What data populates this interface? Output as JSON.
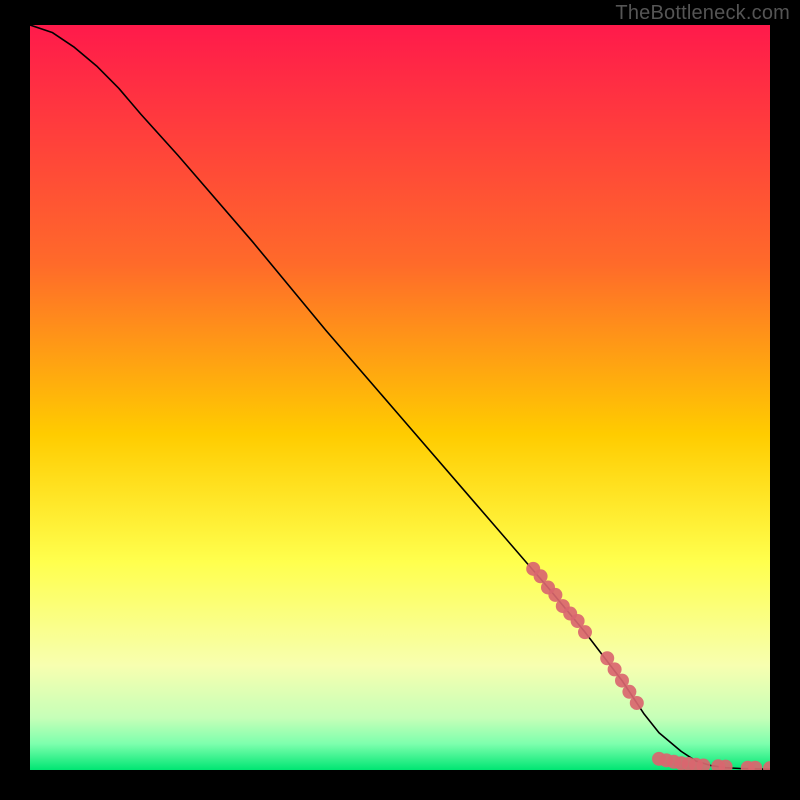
{
  "watermark": "TheBottleneck.com",
  "chart_data": {
    "type": "line",
    "title": "",
    "xlabel": "",
    "ylabel": "",
    "xlim": [
      0,
      100
    ],
    "ylim": [
      0,
      100
    ],
    "grid": false,
    "legend": false,
    "background_gradient": {
      "top": "#ff1a4b",
      "mid_upper": "#ff8a00",
      "mid": "#ffff33",
      "mid_lower": "#e6ffb3",
      "bottom": "#00e673"
    },
    "series": [
      {
        "name": "curve",
        "type": "line",
        "color": "#000000",
        "x": [
          0,
          3,
          6,
          9,
          12,
          15,
          20,
          30,
          40,
          50,
          60,
          70,
          75,
          80,
          83,
          85,
          88,
          90,
          92,
          94,
          96,
          98,
          100
        ],
        "y": [
          100,
          99,
          97,
          94.5,
          91.5,
          88,
          82.5,
          71,
          59,
          47.5,
          36,
          24.5,
          18.5,
          12,
          7.5,
          5,
          2.5,
          1.2,
          0.6,
          0.3,
          0.2,
          0.15,
          0.1
        ]
      },
      {
        "name": "marker-cluster-upper",
        "type": "scatter",
        "color": "#d9666f",
        "x": [
          68,
          69,
          70,
          71,
          72,
          73,
          74,
          75
        ],
        "y": [
          27,
          26,
          24.5,
          23.5,
          22,
          21,
          20,
          18.5
        ]
      },
      {
        "name": "marker-cluster-mid",
        "type": "scatter",
        "color": "#d9666f",
        "x": [
          78,
          79,
          80,
          81,
          82
        ],
        "y": [
          15,
          13.5,
          12,
          10.5,
          9
        ]
      },
      {
        "name": "marker-cluster-bottom",
        "type": "scatter",
        "color": "#d9666f",
        "x": [
          85,
          86,
          87,
          88,
          89,
          90,
          91,
          93,
          94,
          97,
          98,
          100
        ],
        "y": [
          1.5,
          1.3,
          1.1,
          0.9,
          0.8,
          0.7,
          0.6,
          0.5,
          0.45,
          0.3,
          0.3,
          0.25
        ]
      }
    ]
  }
}
